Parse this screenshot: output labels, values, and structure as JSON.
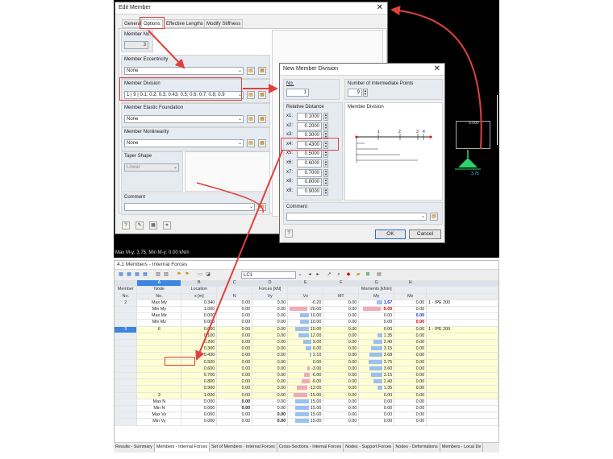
{
  "viewport": {
    "status": "Max M-y: 3.75, Min M-y: 0.00 kNm",
    "support_top_label": "0.000",
    "support_value": "3.75"
  },
  "edit_member": {
    "title": "Edit Member",
    "tabs": [
      "General",
      "Options",
      "Effective Lengths",
      "Modify Stiffness"
    ],
    "member_no_label": "Member No.",
    "member_no": "3",
    "eccentricity_label": "Member Eccentricity",
    "eccentricity_value": "None",
    "division_label": "Member Division",
    "division_value": "1 | 9 | 0.1; 0.2; 0.3; 0.43; 0.5; 0.6; 0.7; 0.8; 0.9",
    "elastic_label": "Member Elastic Foundation",
    "elastic_value": "None",
    "nonlinearity_label": "Member Nonlinearity",
    "nonlinearity_value": "None",
    "taper_label": "Taper Shape",
    "taper_value": "Linear",
    "comment_label": "Comment"
  },
  "new_division": {
    "title": "New Member Division",
    "no_label": "No.",
    "no_value": "1",
    "points_label": "Number of Intermediate Points",
    "points_value": "9",
    "relative_label": "Relative Distance",
    "distances": [
      {
        "label": "x1:",
        "value": "0.1000"
      },
      {
        "label": "x2:",
        "value": "0.2000"
      },
      {
        "label": "x3:",
        "value": "0.3000"
      },
      {
        "label": "x4:",
        "value": "0.4300"
      },
      {
        "label": "x5:",
        "value": "0.5000"
      },
      {
        "label": "x6:",
        "value": "0.6000"
      },
      {
        "label": "x7:",
        "value": "0.7000"
      },
      {
        "label": "x8:",
        "value": "0.8000"
      },
      {
        "label": "x9:",
        "value": "0.9000"
      }
    ],
    "diagram_label": "Member Division",
    "diagram_ticks": [
      "1",
      "2",
      "3",
      "4"
    ],
    "comment_label": "Comment",
    "ok": "OK",
    "cancel": "Cancel"
  },
  "table": {
    "window_title": "4.1 Members - Internal Forces",
    "load_case": "LC1",
    "col_letters": [
      "A",
      "B",
      "C",
      "D",
      "E",
      "F",
      "G",
      "H"
    ],
    "head1": {
      "member": "Member",
      "node": "Node",
      "location": "Location",
      "forces": "Forces [kN]",
      "moments": "Moments [kNm]"
    },
    "head2": {
      "member": "No.",
      "node": "No.",
      "location": "x [m]",
      "n": "N",
      "vy": "Vy",
      "vz": "Vz",
      "mt": "MT",
      "my": "My",
      "mz": "Mz"
    },
    "rows": [
      {
        "m": "2",
        "n": "Max My",
        "x": "0.340",
        "N": "0.00",
        "Vy": "0.00",
        "Vz": "-0.20",
        "MT": "0.00",
        "My": "1.67",
        "Mz": "0.00",
        "cmt": "1 - IPE 200"
      },
      {
        "m": "",
        "n": "Min My",
        "x": "1.000",
        "N": "0.00",
        "Vy": "0.00",
        "Vz": "-20.00",
        "MT": "0.00",
        "My": "-5.00",
        "Mz": "0.00",
        "cmt": ""
      },
      {
        "m": "",
        "n": "Max Mz",
        "x": "0.000",
        "N": "0.00",
        "Vy": "0.00",
        "Vz": "10.00",
        "MT": "0.00",
        "My": "0.00",
        "Mz": "0.00",
        "cmt": ""
      },
      {
        "m": "",
        "n": "Min Mz",
        "x": "0.000",
        "N": "0.00",
        "Vy": "0.00",
        "Vz": "10.00",
        "MT": "0.00",
        "My": "0.00",
        "Mz": "0.00",
        "cmt": ""
      },
      {
        "m": "3",
        "n": "6",
        "x": "0.000",
        "N": "0.00",
        "Vy": "0.00",
        "Vz": "15.00",
        "MT": "0.00",
        "My": "0.00",
        "Mz": "0.00",
        "cmt": "1 - IPE 200"
      },
      {
        "m": "",
        "n": "",
        "x": "0.100",
        "N": "0.00",
        "Vy": "0.00",
        "Vz": "12.00",
        "MT": "0.00",
        "My": "1.35",
        "Mz": "0.00",
        "cmt": ""
      },
      {
        "m": "",
        "n": "",
        "x": "0.200",
        "N": "0.00",
        "Vy": "0.00",
        "Vz": "9.00",
        "MT": "0.00",
        "My": "2.40",
        "Mz": "0.00",
        "cmt": ""
      },
      {
        "m": "",
        "n": "",
        "x": "0.300",
        "N": "0.00",
        "Vy": "0.00",
        "Vz": "6.00",
        "MT": "0.00",
        "My": "3.15",
        "Mz": "0.00",
        "cmt": ""
      },
      {
        "m": "",
        "n": "",
        "x": "0.430",
        "N": "0.00",
        "Vy": "0.00",
        "Vz": "2.10",
        "MT": "0.00",
        "My": "3.68",
        "Mz": "0.00",
        "cmt": ""
      },
      {
        "m": "",
        "n": "",
        "x": "0.500",
        "N": "0.00",
        "Vy": "0.00",
        "Vz": "0.00",
        "MT": "0.00",
        "My": "3.75",
        "Mz": "0.00",
        "cmt": ""
      },
      {
        "m": "",
        "n": "",
        "x": "0.600",
        "N": "0.00",
        "Vy": "0.00",
        "Vz": "-3.00",
        "MT": "0.00",
        "My": "3.60",
        "Mz": "0.00",
        "cmt": ""
      },
      {
        "m": "",
        "n": "",
        "x": "0.700",
        "N": "0.00",
        "Vy": "0.00",
        "Vz": "-6.00",
        "MT": "0.00",
        "My": "3.15",
        "Mz": "0.00",
        "cmt": ""
      },
      {
        "m": "",
        "n": "",
        "x": "0.800",
        "N": "0.00",
        "Vy": "0.00",
        "Vz": "-9.00",
        "MT": "0.00",
        "My": "2.40",
        "Mz": "0.00",
        "cmt": ""
      },
      {
        "m": "",
        "n": "",
        "x": "0.900",
        "N": "0.00",
        "Vy": "0.00",
        "Vz": "-12.00",
        "MT": "0.00",
        "My": "1.35",
        "Mz": "0.00",
        "cmt": ""
      },
      {
        "m": "",
        "n": "3",
        "x": "1.000",
        "N": "0.00",
        "Vy": "0.00",
        "Vz": "-15.00",
        "MT": "0.00",
        "My": "0.00",
        "Mz": "0.00",
        "cmt": ""
      },
      {
        "m": "",
        "n": "Max N",
        "x": "0.000",
        "N": "0.00",
        "Vy": "0.00",
        "Vz": "15.00",
        "MT": "0.00",
        "My": "0.00",
        "Mz": "0.00",
        "cmt": ""
      },
      {
        "m": "",
        "n": "Min N",
        "x": "0.000",
        "N": "0.00",
        "Vy": "0.00",
        "Vz": "15.00",
        "MT": "0.00",
        "My": "0.00",
        "Mz": "0.00",
        "cmt": ""
      },
      {
        "m": "",
        "n": "Max Vy",
        "x": "0.000",
        "N": "0.00",
        "Vy": "0.00",
        "Vz": "15.00",
        "MT": "0.00",
        "My": "0.00",
        "Mz": "0.00",
        "cmt": ""
      },
      {
        "m": "",
        "n": "Min Vy",
        "x": "0.000",
        "N": "0.00",
        "Vy": "0.00",
        "Vz": "15.00",
        "MT": "0.00",
        "My": "0.00",
        "Mz": "0.00",
        "cmt": ""
      }
    ]
  },
  "bottom_tabs": [
    "Results - Summary",
    "Members - Internal Forces",
    "Set of Members - Internal Forces",
    "Cross-Sections - Internal Forces",
    "Nodes - Support Forces",
    "Nodes - Deformations",
    "Members - Local De"
  ],
  "colors": {
    "highlight": "#e0413e",
    "negative_bar": "#f2a9b8",
    "positive_bar": "#9bc1ef",
    "selected_row": "#3a86e0",
    "support": "#2fd06a"
  }
}
